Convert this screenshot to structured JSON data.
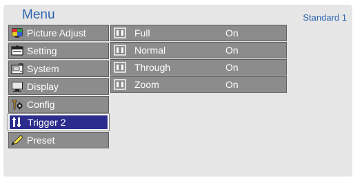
{
  "header": {
    "title": "Menu",
    "mode": "Standard 1"
  },
  "menu": {
    "items": [
      {
        "label": "Picture Adjust",
        "icon": "picture-adjust-icon"
      },
      {
        "label": "Setting",
        "icon": "setting-icon"
      },
      {
        "label": "System",
        "icon": "system-icon"
      },
      {
        "label": "Display",
        "icon": "display-icon"
      },
      {
        "label": "Config",
        "icon": "config-icon"
      },
      {
        "label": "Trigger 2",
        "icon": "trigger-icon",
        "selected": true
      },
      {
        "label": "Preset",
        "icon": "preset-icon"
      }
    ]
  },
  "submenu": {
    "items": [
      {
        "label": "Full",
        "value": "On",
        "icon": "aspect-icon"
      },
      {
        "label": "Normal",
        "value": "On",
        "icon": "aspect-icon"
      },
      {
        "label": "Through",
        "value": "On",
        "icon": "aspect-icon"
      },
      {
        "label": "Zoom",
        "value": "On",
        "icon": "aspect-icon"
      }
    ]
  },
  "colors": {
    "panel_bg": "#e6e6e6",
    "item_bg": "#8c8c8c",
    "selected_bg": "#2c2c8c",
    "title": "#2d64b0"
  }
}
